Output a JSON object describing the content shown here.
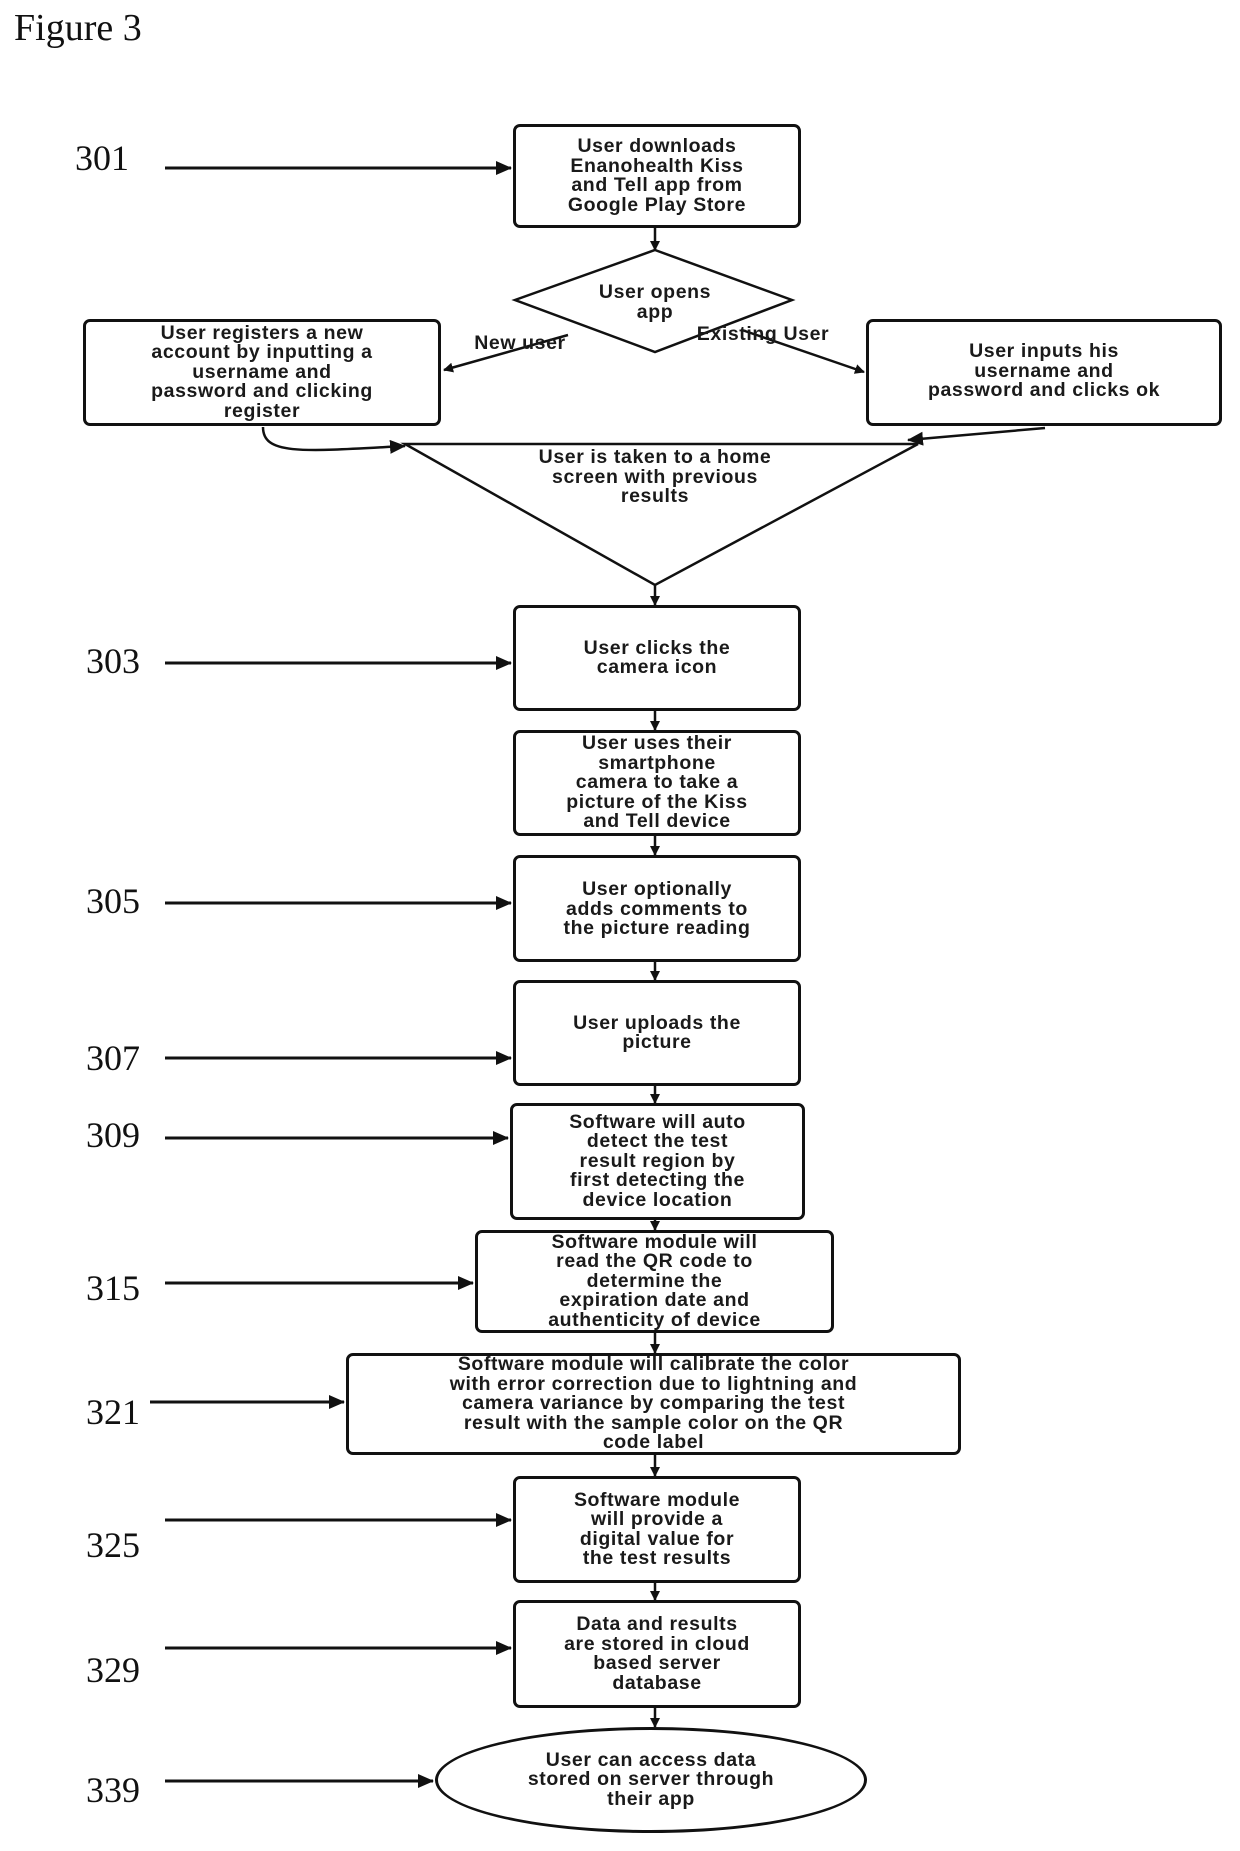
{
  "figure": {
    "title": "Figure 3"
  },
  "refs": {
    "r301": "301",
    "r303": "303",
    "r305": "305",
    "r307": "307",
    "r309": "309",
    "r315": "315",
    "r321": "321",
    "r325": "325",
    "r329": "329",
    "r339": "339"
  },
  "nodes": {
    "download": "User downloads\nEnanohealth Kiss\nand Tell app from\nGoogle Play Store",
    "opens_app": "User opens\napp",
    "register": "User registers a new\naccount by inputting a\nusername and\npassword and clicking\nregister",
    "login": "User inputs his\nusername and\npassword and clicks ok",
    "home_screen": "User is taken to a home\nscreen with previous\nresults",
    "camera_icon": "User clicks the\ncamera icon",
    "take_picture": "User uses their\nsmartphone\ncamera to take a\npicture of the Kiss\nand Tell device",
    "comments": "User optionally\nadds comments to\nthe picture reading",
    "upload": "User uploads the\npicture",
    "auto_detect": "Software will auto\ndetect the test\nresult region by\nfirst detecting the\ndevice location",
    "read_qr": "Software module will\nread the QR code to\ndetermine the\nexpiration date and\nauthenticity of device",
    "calibrate": "Software module will calibrate the color\nwith error correction due to lightning and\ncamera variance by comparing the test\nresult with the sample color on the QR\ncode label",
    "digital_value": "Software module\nwill provide a\ndigital value for\nthe test results",
    "store_data": "Data and results\nare stored in cloud\nbased server\ndatabase",
    "access_data": "User can access data\nstored on server through\ntheir app"
  },
  "edge_labels": {
    "new_user": "New user",
    "existing_user": "Existing User"
  }
}
